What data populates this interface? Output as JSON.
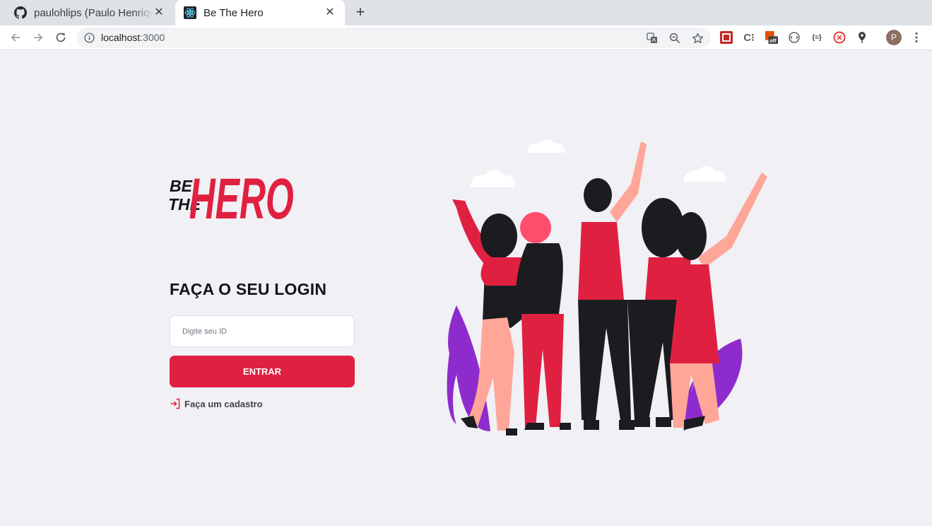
{
  "browser": {
    "tabs": [
      {
        "title": "paulohlips (Paulo Henrique",
        "icon": "github-icon",
        "active": false
      },
      {
        "title": "Be The Hero",
        "icon": "react-icon",
        "active": true
      }
    ],
    "new_tab_symbol": "+",
    "close_symbol": "✕",
    "url_host": "localhost",
    "url_port": ":3000",
    "profile_initial": "P",
    "extensions": [
      "extension-1",
      "extension-c",
      "extension-off",
      "extension-devtools",
      "extension-json",
      "extension-lastpass",
      "extension-map-pin"
    ],
    "extension_off_label": "off"
  },
  "login": {
    "logo": {
      "line1": "BE",
      "line2": "THE",
      "main": "HERO"
    },
    "title": "FAÇA O SEU LOGIN",
    "id_placeholder": "Digite seu ID",
    "id_value": "",
    "submit_label": "ENTRAR",
    "register_label": "Faça um cadastro"
  },
  "colors": {
    "brand": "#e02041",
    "background": "#f0f0f5",
    "text_dark": "#13131a",
    "text_muted": "#41414d"
  }
}
